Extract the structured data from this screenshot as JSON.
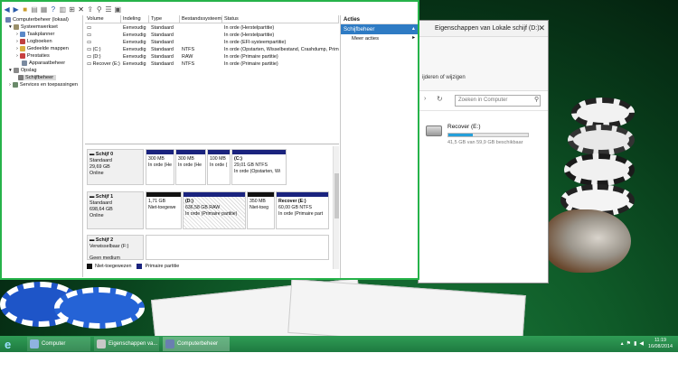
{
  "main_window": {
    "tree": [
      {
        "label": "Computerbeheer (lokaal)",
        "icon": "computer-management-icon"
      },
      {
        "label": "Systeemwerkset",
        "icon": "tools-icon"
      },
      {
        "label": "Taakplanner",
        "icon": "clock-icon"
      },
      {
        "label": "Logboeken",
        "icon": "log-icon"
      },
      {
        "label": "Gedeelde mappen",
        "icon": "shared-folder-icon"
      },
      {
        "label": "Prestaties",
        "icon": "performance-icon"
      },
      {
        "label": "Apparaatbeheer",
        "icon": "device-icon"
      },
      {
        "label": "Opslag",
        "icon": "storage-icon"
      },
      {
        "label": "Schijfbeheer",
        "icon": "disk-icon"
      },
      {
        "label": "Services en toepassingen",
        "icon": "services-icon"
      }
    ],
    "volume_headers": [
      "Volume",
      "Indeling",
      "Type",
      "Bestandssysteem",
      "Status"
    ],
    "volume_rows": [
      [
        "",
        "Eenvoudig",
        "Standaard",
        "",
        "In orde (Herstelpartitie)"
      ],
      [
        "",
        "Eenvoudig",
        "Standaard",
        "",
        "In orde (Herstelpartitie)"
      ],
      [
        "",
        "Eenvoudig",
        "Standaard",
        "",
        "In orde (EFI-systeempartitie)"
      ],
      [
        "(C:)",
        "Eenvoudig",
        "Standaard",
        "NTFS",
        "In orde (Opstarten, Wisselbestand, Crashdump, Prim"
      ],
      [
        "(D:)",
        "Eenvoudig",
        "Standaard",
        "RAW",
        "In orde (Primaire partitie)"
      ],
      [
        "Recover (E:)",
        "Eenvoudig",
        "Standaard",
        "NTFS",
        "In orde (Primaire partitie)"
      ]
    ],
    "disks": [
      {
        "label": "Schijf 0",
        "type": "Standaard",
        "size": "29,69 GB",
        "status": "Online",
        "partitions": [
          {
            "name": "",
            "size": "300 MB",
            "status": "In orde (He"
          },
          {
            "name": "",
            "size": "300 MB",
            "status": "In orde (He"
          },
          {
            "name": "",
            "size": "100 MB",
            "status": "In orde ("
          },
          {
            "name": "(C:)",
            "size": "29,01 GB NTFS",
            "status": "In orde (Opstarten, Wi"
          }
        ]
      },
      {
        "label": "Schijf 1",
        "type": "Standaard",
        "size": "698,64 GB",
        "status": "Online",
        "partitions": [
          {
            "name": "",
            "size": "1,71 GB",
            "status": "Niet-toegewe"
          },
          {
            "name": "(D:)",
            "size": "636,58 GB RAW",
            "status": "In orde (Primaire partitie)"
          },
          {
            "name": "",
            "size": "350 MB",
            "status": "Niet-toeg"
          },
          {
            "name": "Recover  (E:)",
            "size": "60,00 GB NTFS",
            "status": "In orde (Primaire part"
          }
        ]
      },
      {
        "label": "Schijf 2",
        "type": "Verwisselbaar (F:)",
        "size": "",
        "status": "Geen medium",
        "partitions": []
      }
    ],
    "legend": [
      {
        "label": "Niet-toegewezen",
        "color": "#111111"
      },
      {
        "label": "Primaire partitie",
        "color": "#1a237e"
      }
    ],
    "actions": {
      "header": "Acties",
      "section": "Schijfbeheer",
      "more": "Meer acties"
    }
  },
  "explorer_window": {
    "title": "Eigenschappen van Lokale schijf (D:)",
    "ribbon_text": "ijderen of wijzigen",
    "search_placeholder": "Zoeken in Computer",
    "drive_name": "Recover (E:)",
    "drive_free": "41,5 GB van 59,9 GB beschikbaar",
    "drive_used_fraction": 0.31
  },
  "taskbar": {
    "items": [
      {
        "label": "Computer",
        "icon": "computer-icon"
      },
      {
        "label": "Eigenschappen va...",
        "icon": "properties-icon"
      },
      {
        "label": "Computerbeheer",
        "icon": "computer-management-icon"
      }
    ],
    "time": "11:19",
    "date": "16/08/2014"
  },
  "colors": {
    "window_border": "#26b34a",
    "primary_partition": "#1a237e",
    "unallocated": "#111111",
    "selection": "#2e7bc4",
    "taskbar": "#2f9c55"
  }
}
